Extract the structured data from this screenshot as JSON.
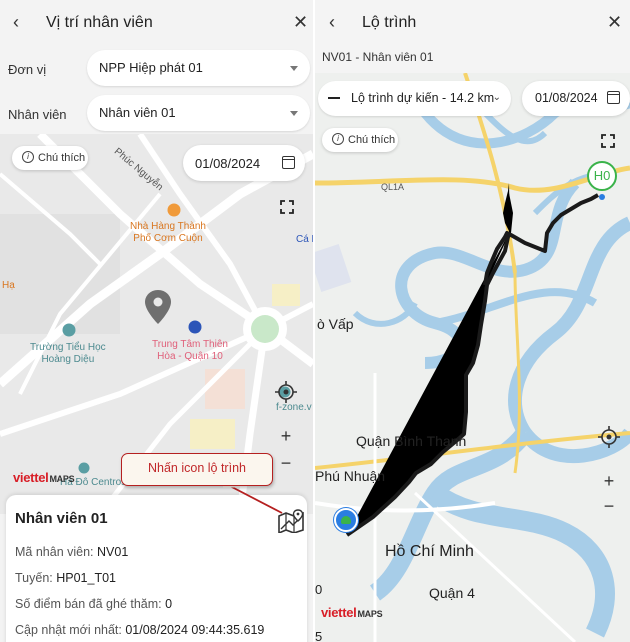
{
  "left": {
    "header": {
      "back_glyph": "‹",
      "title": "Vị trí nhân viên",
      "close_glyph": "✕"
    },
    "don_vi": {
      "label": "Đơn vị",
      "value": "NPP Hiệp phát 01"
    },
    "nhan_vien": {
      "label": "Nhân viên",
      "value": "Nhân viên 01"
    },
    "legend_button": "Chú thích",
    "date": "01/08/2024",
    "map_labels": {
      "street": "Phúc Nguyễn",
      "restaurant": "Nhà Hàng Thành\nPhố Cơm Cuộn",
      "school": "Trường Tiểu Học\nHoàng Diệu",
      "mall": "Trung Tâm Thiên\nHòa - Quận 10",
      "fzone": "f-zone.v",
      "ha": "Hạ",
      "garden": "Hà Đô Centrosa Garden",
      "ca": "Cá H"
    },
    "zoom_in": "+",
    "zoom_out": "−",
    "logo": {
      "brand": "viettel",
      "suffix": "MAPS"
    },
    "callout": "Nhấn icon lộ trình",
    "card": {
      "name": "Nhân viên 01",
      "lines": [
        {
          "label": "Mã nhân viên: ",
          "value": "NV01"
        },
        {
          "label": "Tuyến: ",
          "value": "HP01_T01"
        },
        {
          "label": "Số điểm bán đã ghé thăm: ",
          "value": "0"
        },
        {
          "label": "Cập nhật mới nhất: ",
          "value": "01/08/2024 09:44:35.619"
        }
      ]
    }
  },
  "right": {
    "header": {
      "back_glyph": "‹",
      "title": "Lộ trình",
      "close_glyph": "✕"
    },
    "subtitle": "NV01 - Nhân viên 01",
    "route_select": "Lộ trình dự kiến - 14.2 km",
    "date": "01/08/2024",
    "legend_button": "Chú thích",
    "marker_label": "H0",
    "map_labels": {
      "ql1a": "QL1A",
      "govap": "ò Vấp",
      "binhthanh": "Quận Bình Thạnh",
      "phunhuan": "Phú Nhuận",
      "hcm": "Hồ Chí Minh",
      "quan4": "Quận 4",
      "edge0": "0",
      "edge5": "5"
    },
    "zoom_in": "+",
    "zoom_out": "−",
    "logo": {
      "brand": "viettel",
      "suffix": "MAPS"
    }
  },
  "colors": {
    "route": "#1a1a1a",
    "river": "#a7cde8",
    "major_road": "#f5d36a",
    "callout_border": "#b52020",
    "marker_green": "#3ab34a",
    "logo_red": "#d81e27"
  }
}
